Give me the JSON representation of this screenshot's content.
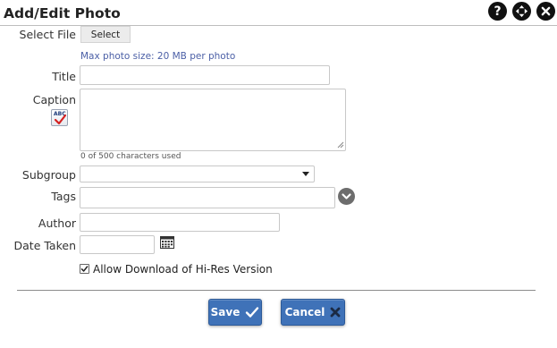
{
  "dialog": {
    "title": "Add/Edit Photo",
    "help_glyph": "?",
    "icons": [
      "help-icon",
      "move-icon",
      "close-icon"
    ]
  },
  "form": {
    "select_file": {
      "label": "Select File",
      "button": "Select"
    },
    "size_hint": "Max photo size: 20 MB per photo",
    "title": {
      "label": "Title",
      "value": ""
    },
    "caption": {
      "label": "Caption",
      "value": "",
      "spellcheck_icon": "spellcheck-icon",
      "char_count": "0 of 500 characters used"
    },
    "subgroup": {
      "label": "Subgroup",
      "selected": ""
    },
    "tags": {
      "label": "Tags",
      "value": "",
      "toggle_icon": "chevron-down-icon"
    },
    "author": {
      "label": "Author",
      "value": ""
    },
    "date_taken": {
      "label": "Date Taken",
      "value": "",
      "calendar_icon": "calendar-icon"
    },
    "allow_download": {
      "label": "Allow Download of Hi-Res Version",
      "checked": true
    }
  },
  "actions": {
    "save": "Save",
    "cancel": "Cancel"
  },
  "colors": {
    "button_blue": "#3f72b8",
    "hint_text": "#4b5fa6",
    "header_icon": "#111111",
    "tags_toggle": "#6d6d6d"
  }
}
